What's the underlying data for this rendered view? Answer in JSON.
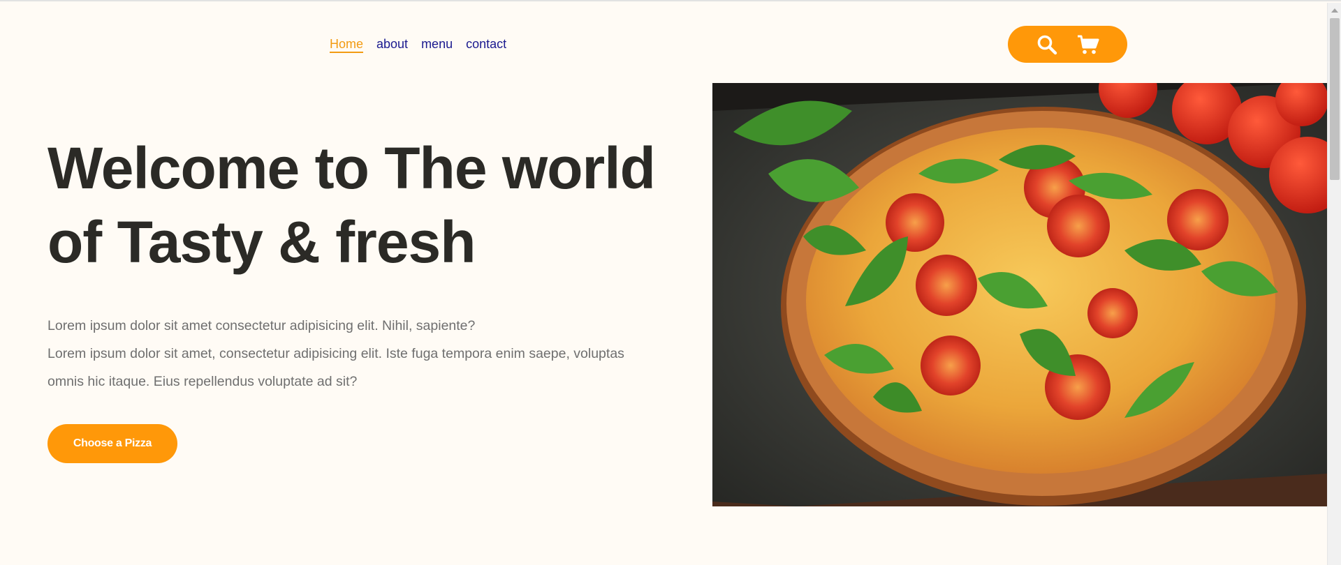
{
  "nav": {
    "items": [
      {
        "label": "Home",
        "active": true
      },
      {
        "label": "about",
        "active": false
      },
      {
        "label": "menu",
        "active": false
      },
      {
        "label": "contact",
        "active": false
      }
    ]
  },
  "actions": {
    "icons": [
      "search-icon",
      "cart-icon"
    ],
    "background": "#ff9809"
  },
  "hero": {
    "headline_line1": "Welcome to The world",
    "headline_line2": "of Tasty & fresh",
    "desc_line1": "Lorem ipsum dolor sit amet consectetur adipisicing elit. Nihil, sapiente?",
    "desc_line2": "Lorem ipsum dolor sit amet, consectetur adipisicing elit. Iste fuga tempora enim saepe, voluptas",
    "desc_line3": "omnis hic itaque. Eius repellendus voluptate ad sit?",
    "cta_label": "Choose a Pizza",
    "image_subject": "pizza with tomatoes and basil"
  },
  "colors": {
    "accent": "#ff9809",
    "active_link": "#f29b13",
    "nav_link": "#1a1a8f",
    "headline": "#2b2a26",
    "body_text": "#6f6f6f",
    "background": "#fffbf5"
  }
}
